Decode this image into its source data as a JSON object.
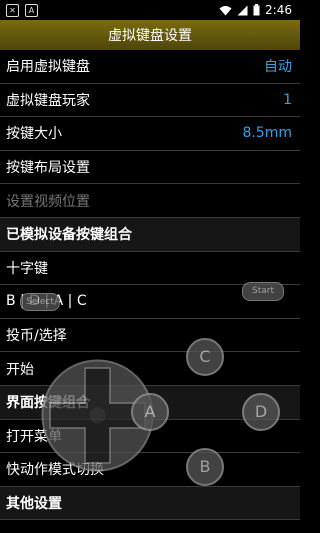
{
  "status_bar": {
    "time": "2:46",
    "left_icons": [
      "notification-icon",
      "app-icon"
    ],
    "right_icons": [
      "wifi-icon",
      "signal-icon",
      "battery-icon"
    ]
  },
  "title": "虚拟键盘设置",
  "rows": [
    {
      "label": "启用虚拟键盘",
      "value": "自动",
      "type": "setting"
    },
    {
      "label": "虚拟键盘玩家",
      "value": "1",
      "type": "setting"
    },
    {
      "label": "按键大小",
      "value": "8.5mm",
      "type": "setting"
    },
    {
      "label": "按键布局设置",
      "value": "",
      "type": "setting"
    },
    {
      "label": "设置视频位置",
      "value": "",
      "type": "disabled"
    },
    {
      "label": "已模拟设备按键组合",
      "value": "",
      "type": "section"
    },
    {
      "label": "十字键",
      "value": "",
      "type": "setting"
    },
    {
      "label": "B | D | A | C",
      "value": "",
      "type": "setting"
    },
    {
      "label": "投币/选择",
      "value": "",
      "type": "setting"
    },
    {
      "label": "开始",
      "value": "",
      "type": "setting"
    },
    {
      "label": "界面按键组合",
      "value": "",
      "type": "section"
    },
    {
      "label": "打开菜单",
      "value": "",
      "type": "setting"
    },
    {
      "label": "快动作模式切换",
      "value": "",
      "type": "setting"
    },
    {
      "label": "其他设置",
      "value": "",
      "type": "section"
    }
  ],
  "overlay": {
    "select_label": "Select",
    "start_label": "Start",
    "button_c": "C",
    "button_a": "A",
    "button_d": "D",
    "button_b": "B"
  },
  "colors": {
    "title_bar": "#6b5e0d",
    "value_text": "#3aa0e0",
    "background": "#000000"
  }
}
